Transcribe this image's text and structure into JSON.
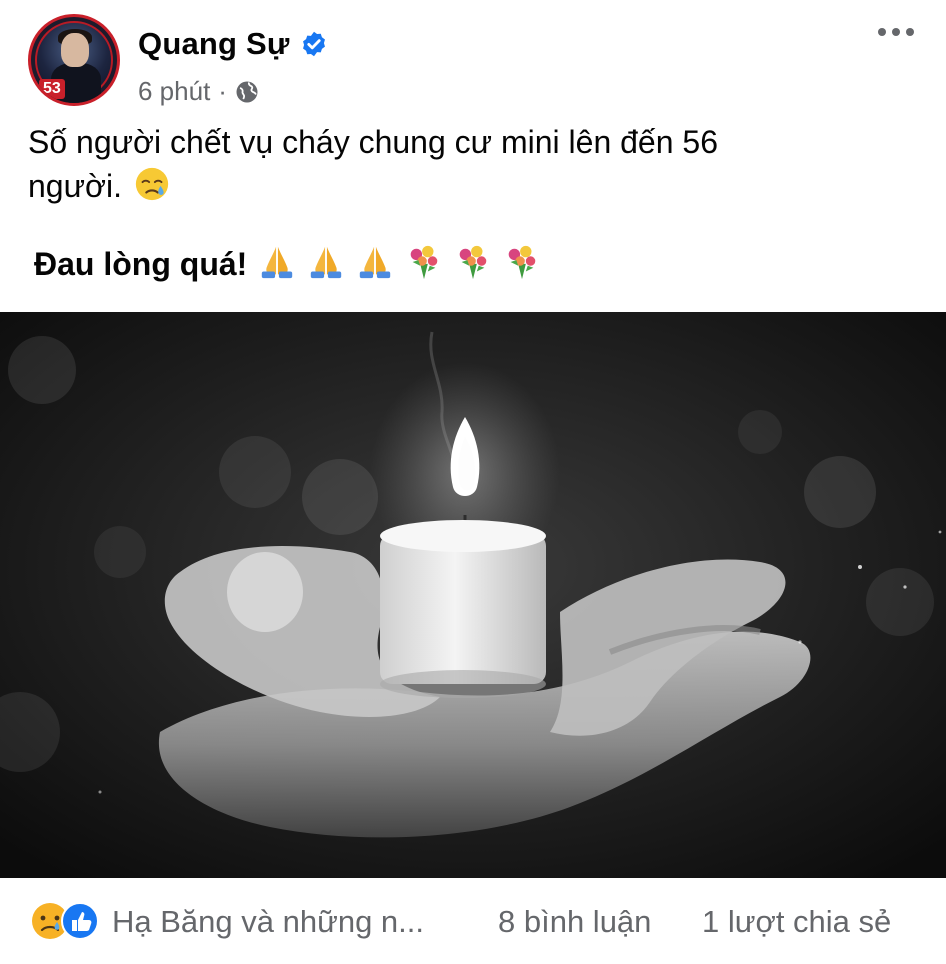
{
  "post": {
    "author": "Quang Sự",
    "avatar_badge": "53",
    "time": "6 phút",
    "separator": "·",
    "privacy_icon": "globe-icon",
    "text_line1": "Số người chết vụ cháy chung cư mini lên đến 56",
    "text_line2": "người.",
    "text_line3": "Đau lòng quá!",
    "emojis_line2": [
      "crying-face"
    ],
    "emojis_line3": [
      "folded-hands",
      "folded-hands",
      "folded-hands",
      "bouquet",
      "bouquet",
      "bouquet"
    ]
  },
  "footer": {
    "reactors": "Hạ Băng và những n...",
    "comments": "8 bình luận",
    "shares": "1 lượt chia sẻ"
  },
  "colors": {
    "verified": "#1877f2",
    "meta_text": "#65676b",
    "like_blue": "#1877f2",
    "sad_yellow": "#f7b125"
  }
}
